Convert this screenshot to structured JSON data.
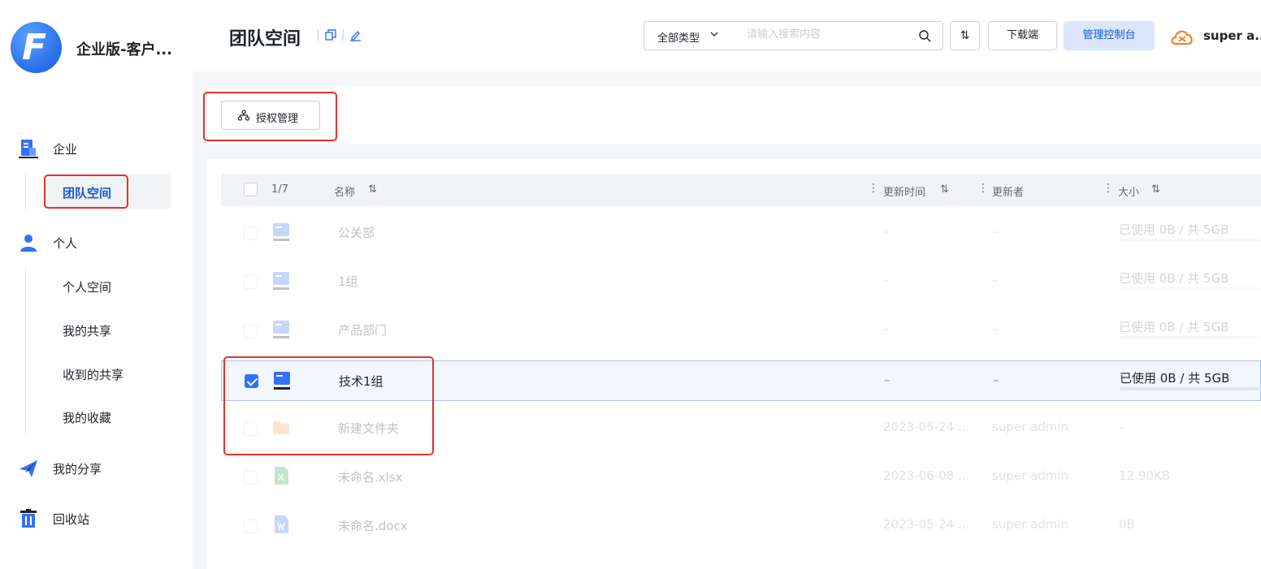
{
  "sidebar": {
    "org_name": "企业版-客户...",
    "logo_letter": "F",
    "groups": [
      {
        "label": "企业",
        "icon": "building-icon"
      },
      {
        "label": "个人",
        "icon": "person-icon"
      },
      {
        "label": "我的分享",
        "icon": "paper-plane-icon"
      },
      {
        "label": "回收站",
        "icon": "trash-icon"
      }
    ],
    "enterprise_items": [
      {
        "label": "团队空间"
      }
    ],
    "personal_items": [
      {
        "label": "个人空间"
      },
      {
        "label": "我的共享"
      },
      {
        "label": "收到的共享"
      },
      {
        "label": "我的收藏"
      }
    ]
  },
  "header": {
    "title": "团队空间",
    "type_select": "全部类型",
    "search_placeholder": "请输入搜索内容",
    "sort_label": "⇅",
    "download_label": "下载端",
    "admin_label": "管理控制台",
    "user_name": "super a.."
  },
  "toolbar": {
    "auth_label": "授权管理"
  },
  "table": {
    "count": "1/7",
    "sort_glyph": "⇅",
    "columns": {
      "name": "名称",
      "updated": "更新时间",
      "updater": "更新者",
      "size": "大小"
    },
    "rows": [
      {
        "name": "公关部",
        "updated": "–",
        "updater": "–",
        "size": "已使用 0B / 共 5GB",
        "type": "team-space"
      },
      {
        "name": "1组",
        "updated": "–",
        "updater": "–",
        "size": "已使用 0B / 共 5GB",
        "type": "team-space"
      },
      {
        "name": "产品部门",
        "updated": "–",
        "updater": "–",
        "size": "已使用 0B / 共 5GB",
        "type": "team-space"
      },
      {
        "name": "技术1组",
        "updated": "–",
        "updater": "–",
        "size": "已使用 0B / 共 5GB",
        "type": "team-space"
      },
      {
        "name": "新建文件夹",
        "updated": "2023-05-24 ...",
        "updater": "super admin",
        "size": "–",
        "type": "folder"
      },
      {
        "name": "未命名.xlsx",
        "updated": "2023-06-08 ...",
        "updater": "super admin",
        "size": "12.90KB",
        "type": "xlsx"
      },
      {
        "name": "未命名.docx",
        "updated": "2023-05-24 ...",
        "updater": "super admin",
        "size": "0B",
        "type": "docx"
      }
    ]
  },
  "colors": {
    "accent": "#3370ff",
    "annotation": "#e5322d"
  }
}
